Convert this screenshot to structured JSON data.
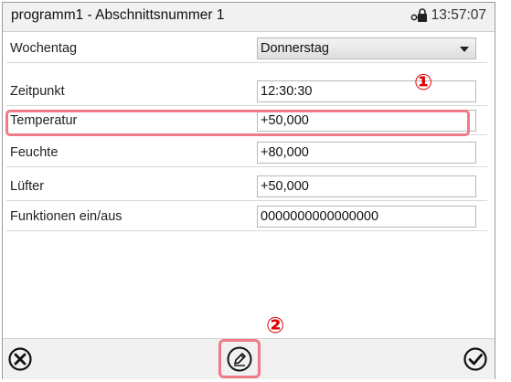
{
  "header": {
    "title": "programm1 - Abschnittsnummer 1",
    "time": "13:57:07",
    "status_icon": "lock-key-icon"
  },
  "rows": [
    {
      "label": "Wochentag",
      "value": "Donnerstag",
      "type": "select"
    },
    {
      "label": "Zeitpunkt",
      "value": "12:30:30",
      "type": "input"
    },
    {
      "label": "Temperatur",
      "value": "+50,000",
      "type": "input"
    },
    {
      "label": "Feuchte",
      "value": "+80,000",
      "type": "input"
    },
    {
      "label": "Lüfter",
      "value": "+50,000",
      "type": "input"
    },
    {
      "label": "Funktionen ein/aus",
      "value": "0000000000000000",
      "type": "input"
    }
  ],
  "annotations": {
    "marker_1": "①",
    "marker_2": "②",
    "color": "#f07a86"
  },
  "footer": {
    "cancel_icon": "close-circle-icon",
    "edit_icon": "pencil-circle-icon",
    "confirm_icon": "check-circle-icon"
  }
}
